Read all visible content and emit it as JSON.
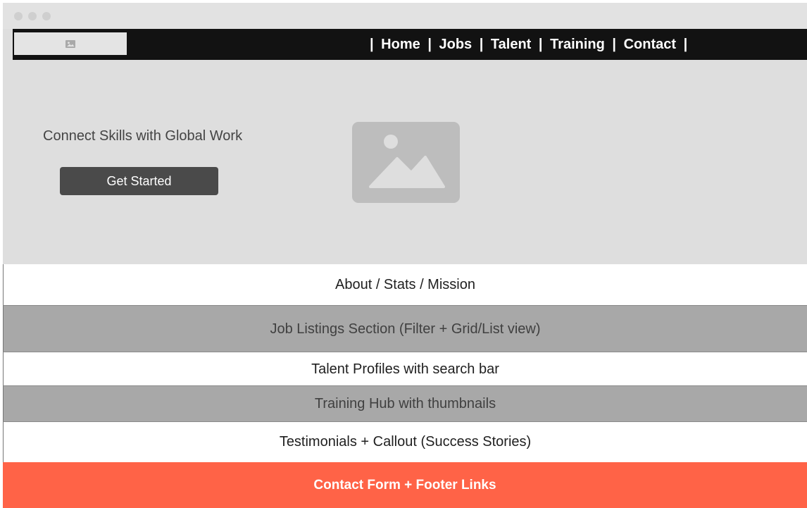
{
  "nav": {
    "pipe": "|",
    "links": [
      "Home",
      "Jobs",
      "Talent",
      "Training",
      "Contact"
    ]
  },
  "hero": {
    "tagline": "Connect Skills with Global Work",
    "cta_label": "Get Started"
  },
  "sections": [
    "About / Stats / Mission",
    "Job Listings Section (Filter + Grid/List view)",
    "Talent Profiles with search bar",
    "Training Hub with thumbnails",
    "Testimonials + Callout (Success Stories)"
  ],
  "footer": {
    "label": "Contact Form + Footer Links"
  },
  "colors": {
    "navbar": "#121212",
    "hero_bg": "#dedede",
    "button": "#4a4a4a",
    "section_gray": "#a8a8a8",
    "footer_accent": "#ff6347"
  },
  "icons": {
    "logo": "image-placeholder-icon",
    "hero_image": "image-placeholder-icon"
  }
}
